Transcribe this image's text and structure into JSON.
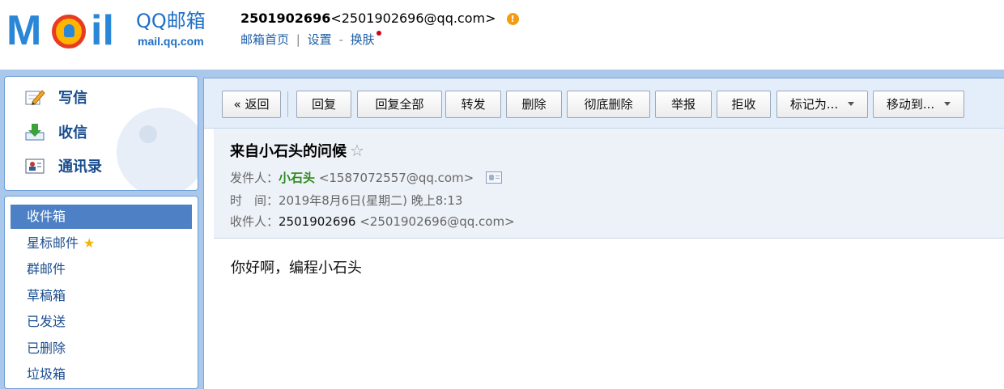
{
  "header": {
    "logo_text_m": "M",
    "logo_text_il": "il",
    "brand": "QQ邮箱",
    "domain": "mail.qq.com",
    "account_number": "2501902696",
    "account_email": "<2501902696@qq.com>",
    "warning_glyph": "!",
    "links": {
      "home": "邮箱首页",
      "divider": "|",
      "settings": "设置",
      "dash": "-",
      "skin": "换肤"
    }
  },
  "quick_actions": [
    {
      "label": "写信",
      "icon": "compose-icon"
    },
    {
      "label": "收信",
      "icon": "inbox-download-icon"
    },
    {
      "label": "通讯录",
      "icon": "contacts-icon"
    }
  ],
  "folders": [
    {
      "label": "收件箱",
      "active": true
    },
    {
      "label": "星标邮件",
      "star": "★"
    },
    {
      "label": "群邮件"
    },
    {
      "label": "草稿箱"
    },
    {
      "label": "已发送"
    },
    {
      "label": "已删除"
    },
    {
      "label": "垃圾箱"
    }
  ],
  "toolbar": {
    "back": "« 返回",
    "reply": "回复",
    "reply_all": "回复全部",
    "forward": "转发",
    "delete": "删除",
    "delete_forever": "彻底删除",
    "report": "举报",
    "reject": "拒收",
    "mark_as": "标记为...",
    "move_to": "移动到..."
  },
  "mail": {
    "subject": "来自小石头的问候",
    "subject_star": "☆",
    "from_label": "发件人：",
    "from_name": "小石头",
    "from_email": "<1587072557@qq.com>",
    "time_label": "时　间：",
    "time_value": "2019年8月6日(星期二) 晚上8:13",
    "to_label": "收件人：",
    "to_name": "2501902696",
    "to_email": "<2501902696@qq.com>",
    "body": "你好啊，编程小石头"
  },
  "colors": {
    "brand_blue": "#2a86d6",
    "frame_blue": "#a9c8ec",
    "active_folder": "#4d80c5",
    "sender_green": "#2f8a1d",
    "warning_orange": "#f39c12",
    "notify_red": "#d0021b"
  }
}
